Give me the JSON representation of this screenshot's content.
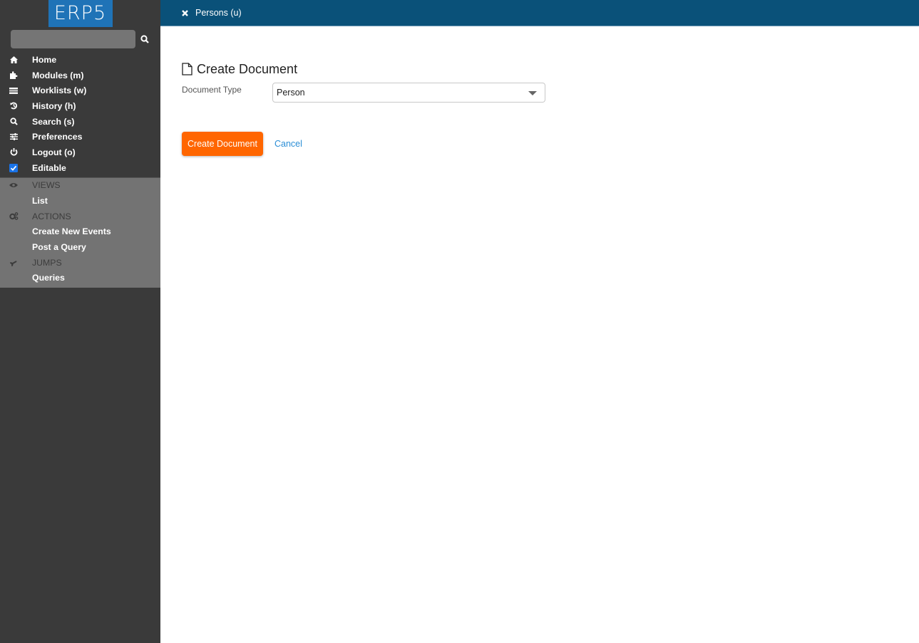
{
  "app": {
    "logo": "ERP5"
  },
  "sidebar": {
    "search": {
      "value": "",
      "placeholder": ""
    },
    "nav": [
      {
        "icon": "home-icon",
        "label": "Home"
      },
      {
        "icon": "puzzle-icon",
        "label": "Modules (m)"
      },
      {
        "icon": "tasks-icon",
        "label": "Worklists (w)"
      },
      {
        "icon": "history-icon",
        "label": "History (h)"
      },
      {
        "icon": "search-icon",
        "label": "Search (s)"
      },
      {
        "icon": "sliders-icon",
        "label": "Preferences"
      },
      {
        "icon": "power-icon",
        "label": "Logout (o)"
      },
      {
        "icon": "checkbox-icon",
        "label": "Editable",
        "checked": true
      }
    ],
    "panel": {
      "views": {
        "heading": "VIEWS",
        "icon": "eye-icon",
        "items": [
          "List"
        ]
      },
      "actions": {
        "heading": "ACTIONS",
        "icon": "cogs-icon",
        "items": [
          "Create New Events",
          "Post a Query"
        ]
      },
      "jumps": {
        "heading": "JUMPS",
        "icon": "plane-icon",
        "items": [
          "Queries"
        ]
      }
    }
  },
  "header": {
    "close_label": "Persons (u)"
  },
  "main": {
    "title": "Create Document",
    "field_label": "Document Type",
    "document_type": "Person",
    "submit_label": "Create Document",
    "cancel_label": "Cancel"
  },
  "colors": {
    "header": "#0a5179",
    "sidebar": "#3a3a3a",
    "panel": "#737373",
    "primary": "#ff6600",
    "link": "#2b8ed6",
    "logo": "#1f73b7"
  }
}
